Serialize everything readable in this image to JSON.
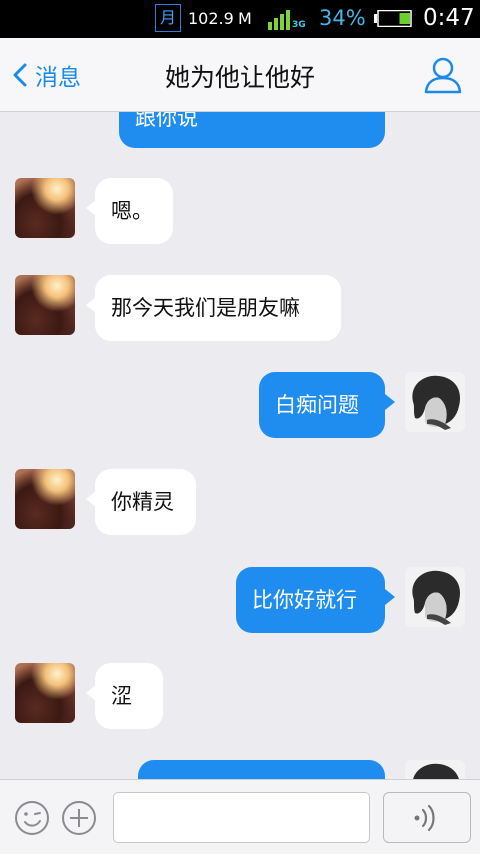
{
  "status_bar": {
    "moon_glyph": "月",
    "net_speed": "102.9",
    "net_unit": "M",
    "network_type": "3G",
    "battery_percent": "34%",
    "battery_level": 0.34,
    "time": "0:47"
  },
  "nav": {
    "back_label": "消息",
    "title": "她为他让他好",
    "icons": {
      "back": "chevron-left-icon",
      "profile": "person-icon"
    }
  },
  "messages": [
    {
      "side": "out",
      "text": "跟你说"
    },
    {
      "side": "in",
      "text": "嗯。"
    },
    {
      "side": "in",
      "text": "那今天我们是朋友嘛"
    },
    {
      "side": "out",
      "text": "白痴问题"
    },
    {
      "side": "in",
      "text": "你精灵"
    },
    {
      "side": "out",
      "text": "比你好就行"
    },
    {
      "side": "in",
      "text": "涩"
    },
    {
      "side": "out",
      "text": ""
    }
  ],
  "input": {
    "value": "",
    "icons": {
      "emoji": "smiley-icon",
      "plus": "plus-icon",
      "voice": "voice-icon"
    }
  },
  "colors": {
    "accent": "#1f8df0",
    "chat_bg": "#ebebf0",
    "incoming_bubble": "#ffffff"
  }
}
